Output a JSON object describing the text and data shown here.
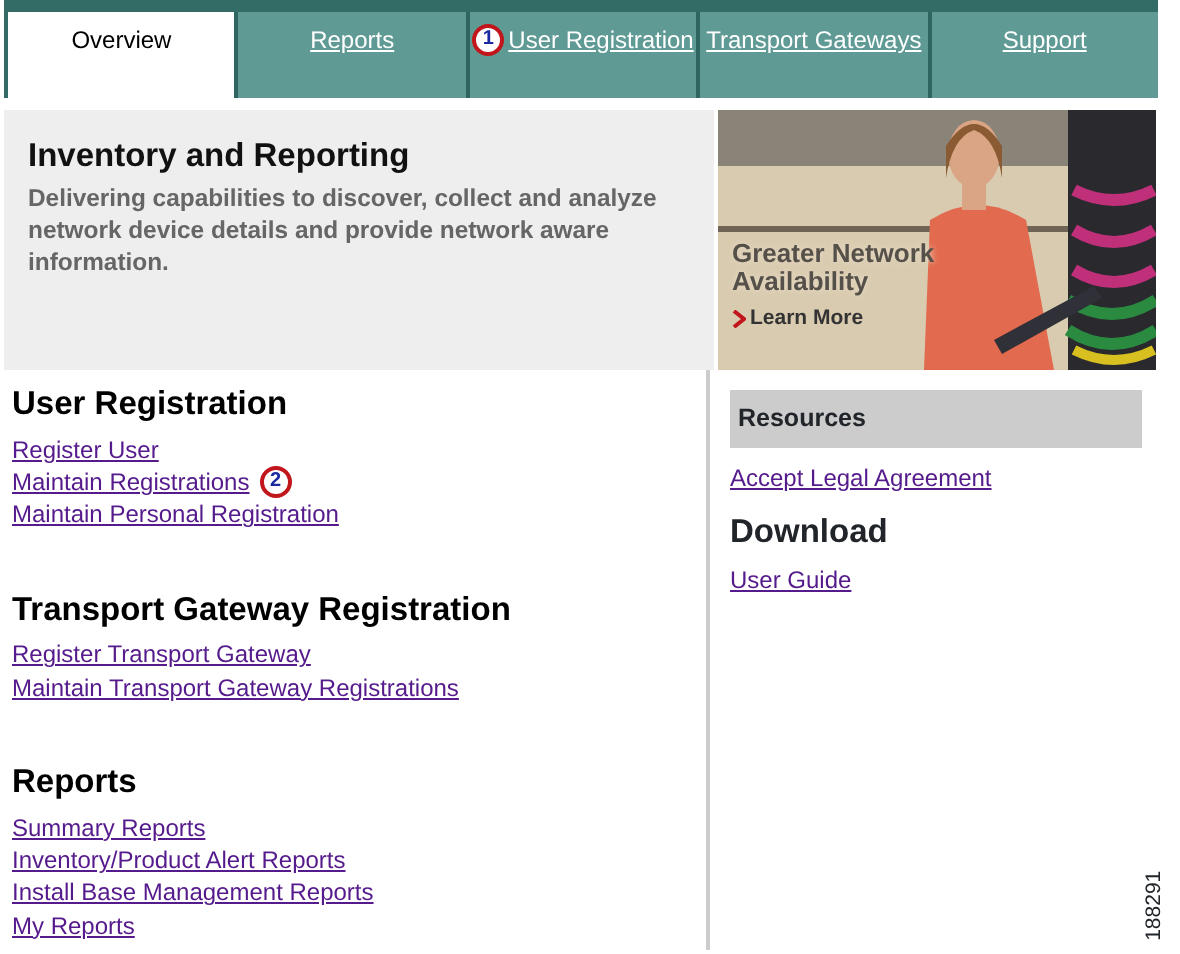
{
  "tabs": [
    {
      "label": "Overview",
      "selected": true
    },
    {
      "label": "Reports",
      "selected": false
    },
    {
      "label": "User Registration",
      "selected": false,
      "callout": "1"
    },
    {
      "label": "Transport Gateways",
      "selected": false
    },
    {
      "label": "Support",
      "selected": false
    }
  ],
  "banner": {
    "title": "Inventory and Reporting",
    "description": "Delivering capabilities to discover, collect and analyze network device details and provide network aware information.",
    "promo": {
      "kind": "picture",
      "headline": "Greater Network Availability",
      "link": "Learn More"
    }
  },
  "sections": [
    {
      "title": "User Registration",
      "links": [
        {
          "label": "Register User"
        },
        {
          "label": "Maintain Registrations",
          "callout": "2"
        },
        {
          "label": "Maintain Personal Registration"
        }
      ]
    },
    {
      "title": "Transport Gateway Registration",
      "links": [
        {
          "label": "Register Transport Gateway"
        },
        {
          "label": "Maintain Transport Gateway Registrations"
        }
      ]
    },
    {
      "title": "Reports",
      "links": [
        {
          "label": "Summary Reports"
        },
        {
          "label": "Inventory/Product Alert Reports"
        },
        {
          "label": "Install Base Management Reports"
        },
        {
          "label": "My Reports"
        }
      ]
    }
  ],
  "resources": {
    "title": "Resources",
    "links": [
      {
        "label": "Accept Legal Agreement"
      }
    ]
  },
  "download": {
    "title": "Download",
    "links": [
      {
        "label": "User Guide"
      }
    ]
  },
  "figure_number": "188291"
}
